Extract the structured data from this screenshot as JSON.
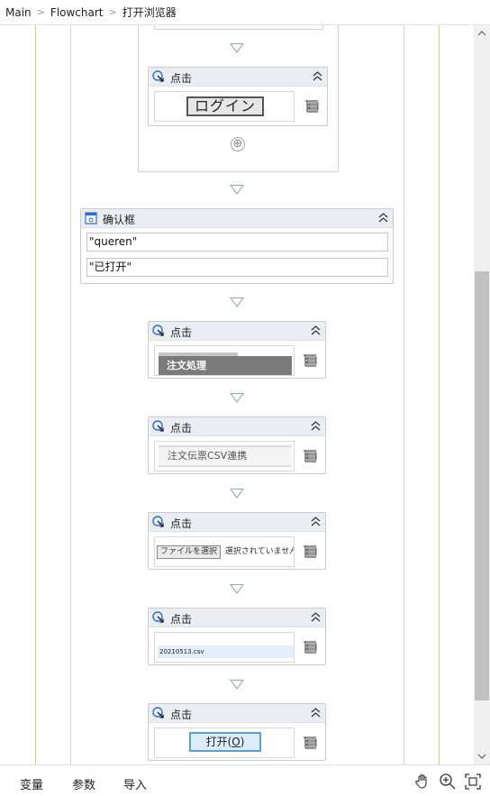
{
  "breadcrumb": {
    "items": [
      "Main",
      "Flowchart",
      "打开浏览器"
    ]
  },
  "activities": [
    {
      "title": "点击",
      "target_text": "ログイン"
    },
    {
      "title": "点击",
      "target_text": "注文処理"
    },
    {
      "title": "点击",
      "target_text": "注文伝票CSV連携"
    },
    {
      "title": "点击",
      "target_text": "選択されていません",
      "button_text": "ファイルを選択"
    },
    {
      "title": "点击",
      "target_text": "20210513.csv"
    },
    {
      "title": "点击",
      "target_text": "打开(",
      "underline": "O",
      "suffix": ")"
    }
  ],
  "confirm": {
    "title": "确认框",
    "field1": "\"queren\"",
    "field2": "\"已打开\""
  },
  "add_symbol": "⊕",
  "bottom_tabs": {
    "variables": "变量",
    "arguments": "参数",
    "imports": "导入"
  },
  "colors": {
    "swimlane": "#e8c870",
    "header_bg": "#eaedf1",
    "accent": "#2a6fd6"
  }
}
